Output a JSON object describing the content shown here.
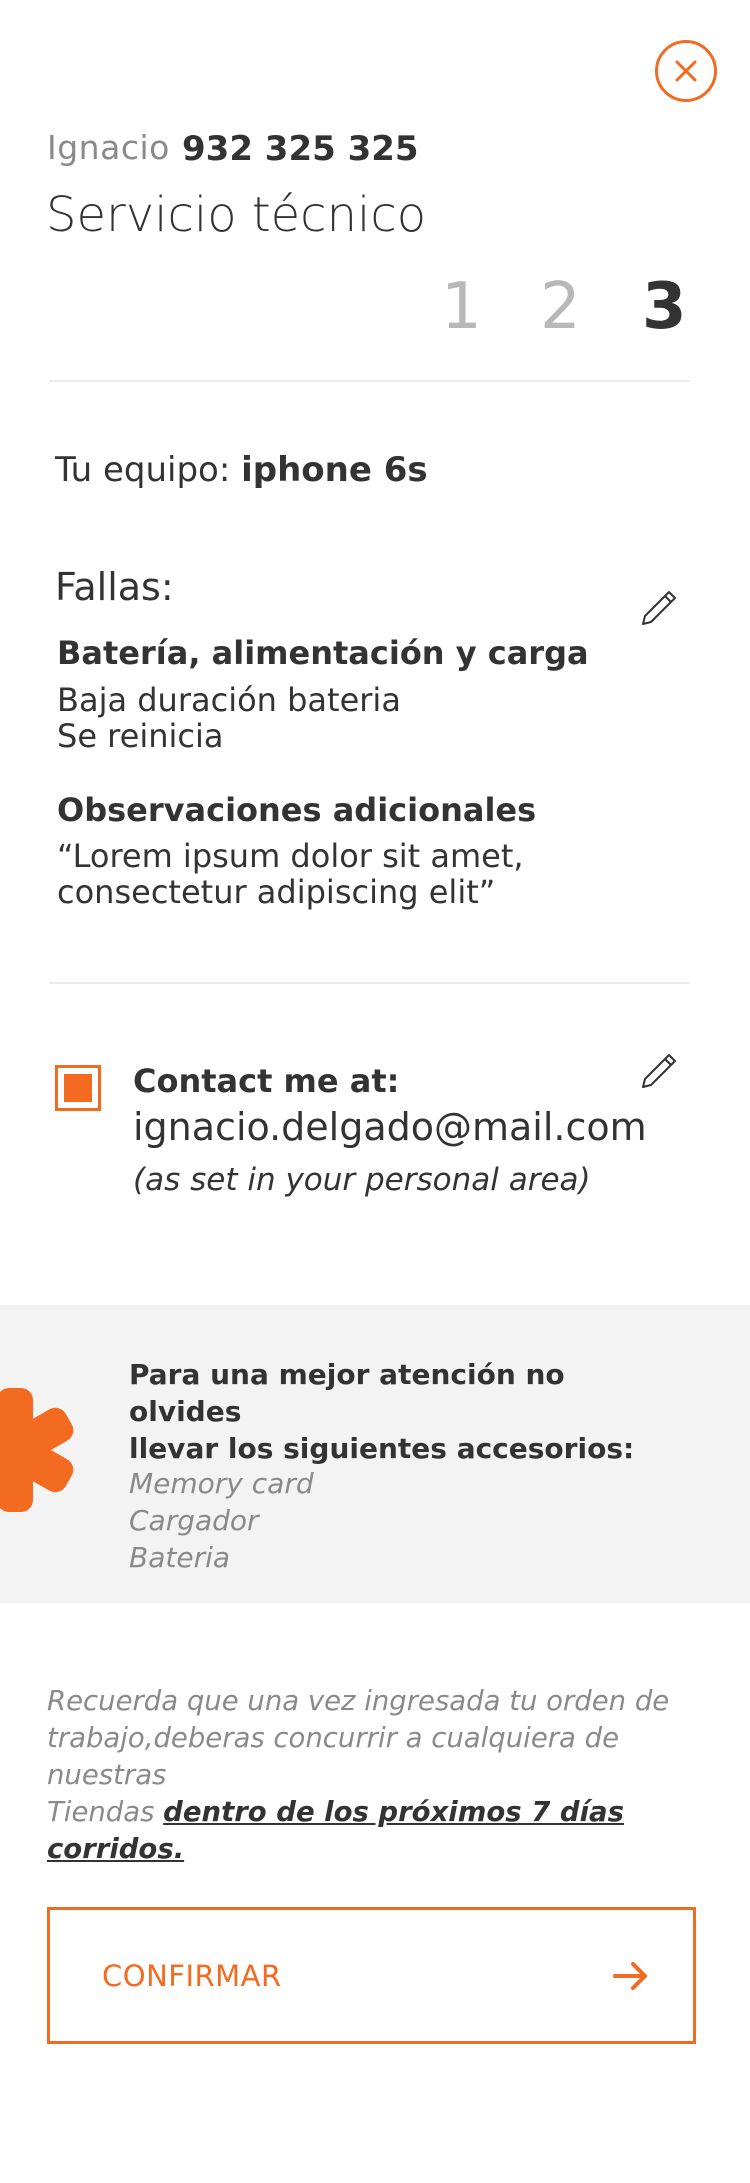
{
  "header": {
    "user_name": "Ignacio",
    "user_phone": "932 325 325",
    "title": "Servicio técnico",
    "steps": [
      "1",
      "2",
      "3"
    ],
    "active_step": 3
  },
  "device": {
    "label": "Tu equipo:",
    "value": "iphone 6s"
  },
  "faults": {
    "heading": "Fallas:",
    "category": "Batería, alimentación y carga",
    "items": [
      "Baja duración bateria",
      "Se reinicia"
    ]
  },
  "observations": {
    "heading": "Observaciones adicionales",
    "lines": [
      "“Lorem ipsum dolor sit amet,",
      "consectetur adipiscing elit”"
    ]
  },
  "contact": {
    "checked": true,
    "label": "Contact me at:",
    "email": "ignacio.delgado@mail.com",
    "note": "(as set in your personal area)"
  },
  "accessories": {
    "title_lines": [
      "Para una mejor atención no olvides",
      "llevar los siguientes accesorios:"
    ],
    "items": [
      "Memory card",
      "Cargador",
      "Bateria"
    ]
  },
  "notice": {
    "lines": [
      "Recuerda que una vez ingresada tu orden de",
      "trabajo,deberas concurrir a cualquiera de nuestras"
    ],
    "prefix": "Tiendas",
    "link": "dentro de los próximos 7 días corridos."
  },
  "confirm": {
    "label": "CONFIRMAR"
  },
  "colors": {
    "accent": "#f26b21",
    "text": "#333333",
    "muted": "#8a8a8a",
    "band": "#f3f3f3"
  },
  "icons": [
    "close-icon",
    "pencil-icon",
    "asterisk-icon",
    "arrow-right-icon"
  ]
}
